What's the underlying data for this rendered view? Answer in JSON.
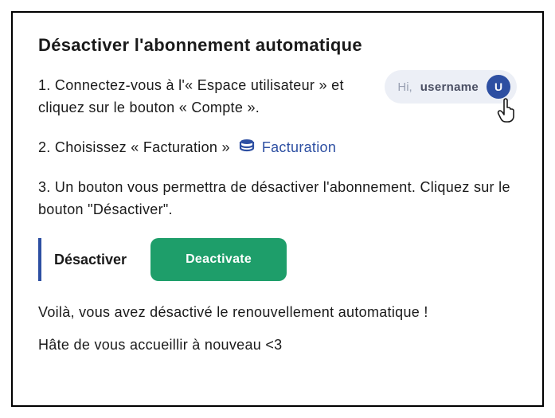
{
  "title": "Désactiver l'abonnement automatique",
  "step1": "1. Connectez-vous à l'« Espace utilisateur » et cliquez sur le bouton « Compte ».",
  "userpill": {
    "hi": "Hi,",
    "username": "username",
    "avatar_letter": "U"
  },
  "step2": "2. Choisissez « Facturation »",
  "facturation_link": "Facturation",
  "step3": "3. Un bouton vous permettra de désactiver l'abonnement. Cliquez sur le bouton \"Désactiver\".",
  "deactivate_label": "Désactiver",
  "deactivate_button": "Deactivate",
  "outro1": "Voilà, vous avez désactivé le renouvellement automatique !",
  "outro2": "Hâte de vous accueillir à nouveau <3",
  "colors": {
    "brand": "#2d4fa2",
    "green": "#1e9e6a",
    "pill_bg": "#eceff6"
  }
}
